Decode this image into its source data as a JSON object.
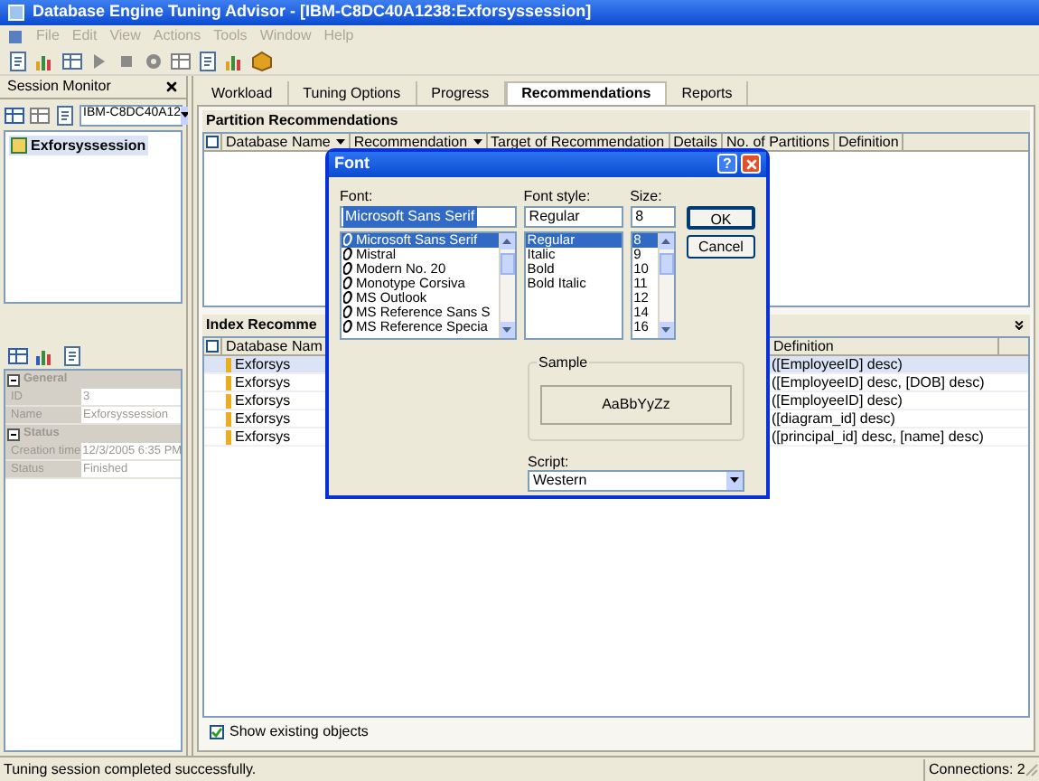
{
  "window": {
    "title": "Database Engine Tuning Advisor - [IBM-C8DC40A1238:Exforsyssession]"
  },
  "menu": [
    {
      "label": "File",
      "disabled": true
    },
    {
      "label": "Edit",
      "disabled": true
    },
    {
      "label": "View",
      "disabled": true
    },
    {
      "label": "Actions",
      "disabled": true
    },
    {
      "label": "Tools",
      "disabled": true
    },
    {
      "label": "Window",
      "disabled": true
    },
    {
      "label": "Help",
      "disabled": true
    }
  ],
  "session_monitor": {
    "title": "Session Monitor",
    "server": "IBM-C8DC40A12",
    "sessions": [
      {
        "label": "Exforsyssession",
        "selected": true
      }
    ],
    "properties": {
      "disabled": true,
      "groups": [
        {
          "category": "General",
          "expanded": true,
          "children": [
            {
              "name": "ID",
              "value": "3"
            },
            {
              "name": "Name",
              "value": "Exforsyssession"
            }
          ]
        },
        {
          "category": "Status",
          "expanded": true,
          "children": [
            {
              "name": "Creation time",
              "value": "12/3/2005 6:35 PM"
            },
            {
              "name": "Status",
              "value": "Finished"
            }
          ]
        }
      ]
    }
  },
  "tabs": [
    {
      "label": "Workload",
      "selected": false
    },
    {
      "label": "Tuning Options",
      "selected": false
    },
    {
      "label": "Progress",
      "selected": false
    },
    {
      "label": "Recommendations",
      "selected": true
    },
    {
      "label": "Reports",
      "selected": false
    }
  ],
  "partition_recommendations": {
    "title": "Partition Recommendations",
    "select_all_checked": false,
    "columns": [
      {
        "label": "Database Name",
        "sortable": true
      },
      {
        "label": "Recommendation",
        "sortable": true
      },
      {
        "label": "Target of Recommendation",
        "sortable": false
      },
      {
        "label": "Details",
        "sortable": false
      },
      {
        "label": "No. of Partitions",
        "sortable": false
      },
      {
        "label": "Definition",
        "sortable": false
      }
    ]
  },
  "index_recommendations": {
    "title": "Index Recomme",
    "select_all_checked": false,
    "columns": [
      "Database Nam",
      "Definition"
    ],
    "rows": [
      {
        "database": "Exforsys",
        "definition": "([EmployeeID] desc)",
        "selected": true
      },
      {
        "database": "Exforsys",
        "definition": "([EmployeeID] desc, [DOB] desc)",
        "selected": false
      },
      {
        "database": "Exforsys",
        "definition": "([EmployeeID] desc)",
        "selected": false
      },
      {
        "database": "Exforsys",
        "definition": "([diagram_id] desc)",
        "selected": false
      },
      {
        "database": "Exforsys",
        "definition": "([principal_id] desc, [name] desc)",
        "selected": false
      }
    ]
  },
  "show_existing_objects": {
    "label": "Show existing objects",
    "checked": true
  },
  "status_bar": {
    "message": "Tuning session completed successfully.",
    "connections": "Connections: 2"
  },
  "font_dialog": {
    "title": "Font",
    "help": "?",
    "font": {
      "label": "Font:",
      "value": "Microsoft Sans Serif",
      "highlighted": true,
      "scrollable": true,
      "items": [
        {
          "label": "Microsoft Sans Serif",
          "kind": "opentype",
          "selected": true
        },
        {
          "label": "Mistral",
          "kind": "opentype",
          "selected": false
        },
        {
          "label": "Modern No. 20",
          "kind": "opentype",
          "selected": false
        },
        {
          "label": "Monotype Corsiva",
          "kind": "opentype",
          "selected": false
        },
        {
          "label": "MS Outlook",
          "kind": "opentype",
          "selected": false
        },
        {
          "label": "MS Reference Sans S",
          "kind": "opentype",
          "selected": false
        },
        {
          "label": "MS Reference Specia",
          "kind": "opentype",
          "selected": false
        }
      ]
    },
    "style": {
      "label": "Font style:",
      "value": "Regular",
      "highlighted": false,
      "scrollable": false,
      "items": [
        {
          "label": "Regular",
          "selected": true
        },
        {
          "label": "Italic",
          "selected": false
        },
        {
          "label": "Bold",
          "selected": false
        },
        {
          "label": "Bold Italic",
          "selected": false
        }
      ]
    },
    "size": {
      "label": "Size:",
      "value": "8",
      "highlighted": false,
      "scrollable": true,
      "items": [
        {
          "label": "8",
          "selected": true
        },
        {
          "label": "9",
          "selected": false
        },
        {
          "label": "10",
          "selected": false
        },
        {
          "label": "11",
          "selected": false
        },
        {
          "label": "12",
          "selected": false
        },
        {
          "label": "14",
          "selected": false
        },
        {
          "label": "16",
          "selected": false
        }
      ]
    },
    "buttons": [
      {
        "label": "OK",
        "default": true
      },
      {
        "label": "Cancel",
        "default": false
      }
    ],
    "sample": {
      "label": "Sample",
      "text": "AaBbYyZz"
    },
    "script": {
      "label": "Script:",
      "value": "Western"
    }
  }
}
